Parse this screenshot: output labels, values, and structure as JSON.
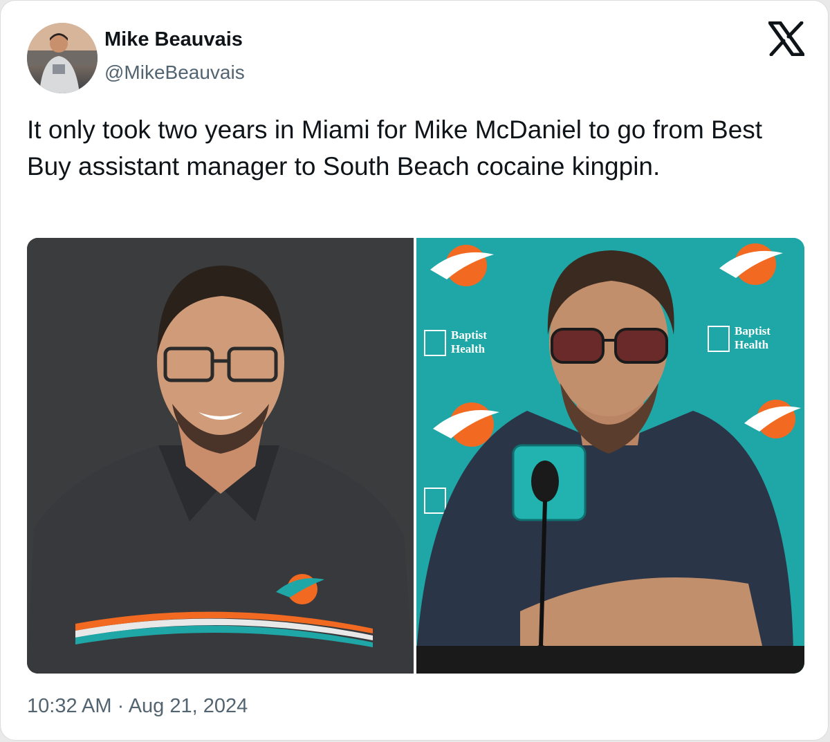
{
  "tweet": {
    "author": {
      "display_name": "Mike Beauvais",
      "handle": "@MikeBeauvais"
    },
    "text": "It only took two years in Miami for Mike McDaniel to go from Best Buy assistant manager to South Beach cocaine kingpin.",
    "timestamp": "10:32 AM · Aug 21, 2024",
    "brand_icon": "x-logo-icon"
  },
  "media": {
    "backdrop": {
      "sponsor_line1": "Baptist",
      "sponsor_line2": "Health"
    }
  },
  "colors": {
    "text": "#0f1419",
    "secondary_text": "#536471",
    "teal": "#1fa6a6",
    "orange": "#f26a21",
    "navy": "#2b3548"
  }
}
